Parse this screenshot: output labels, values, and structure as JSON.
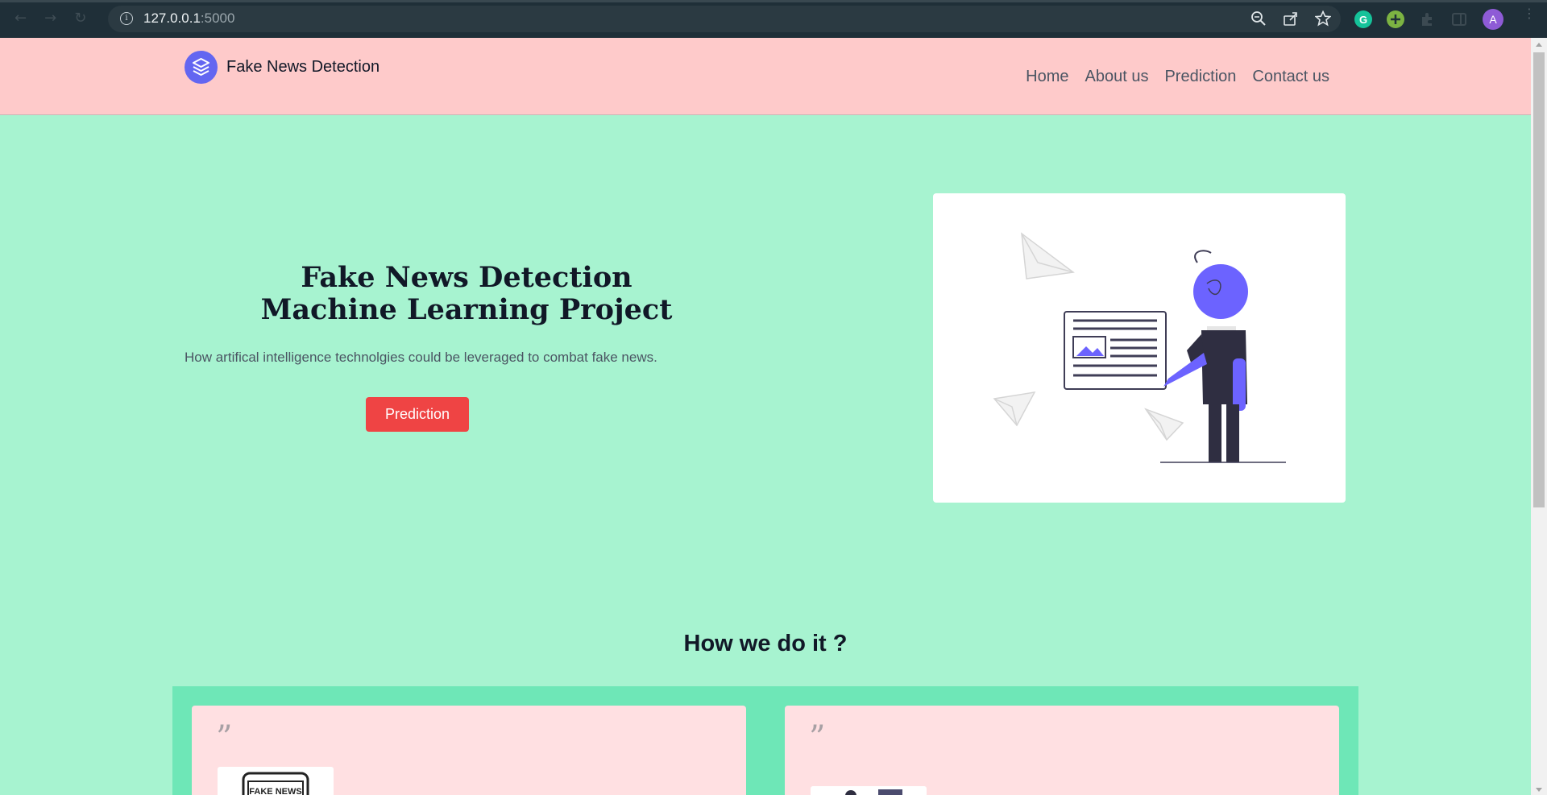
{
  "browser": {
    "url_host": "127.0.0.1",
    "url_port": ":5000",
    "profile_initial": "A"
  },
  "header": {
    "brand": "Fake News Detection",
    "nav": [
      "Home",
      "About us",
      "Prediction",
      "Contact us"
    ]
  },
  "hero": {
    "title_line1": "Fake News Detection",
    "title_line2": "Machine Learning Project",
    "subtitle": "How artifical intelligence technolgies could be leveraged to combat fake news.",
    "button": "Prediction"
  },
  "how": {
    "title": "How we do it ?",
    "quote_mark": "”",
    "thumb1_text": "FAKE NEWS"
  },
  "colors": {
    "header_bg": "#fecaca",
    "page_bg": "#a7f3d0",
    "band_bg": "#6ee7b7",
    "card_bg": "#ffe0e2",
    "accent": "#6366f1",
    "button": "#ef4444"
  }
}
